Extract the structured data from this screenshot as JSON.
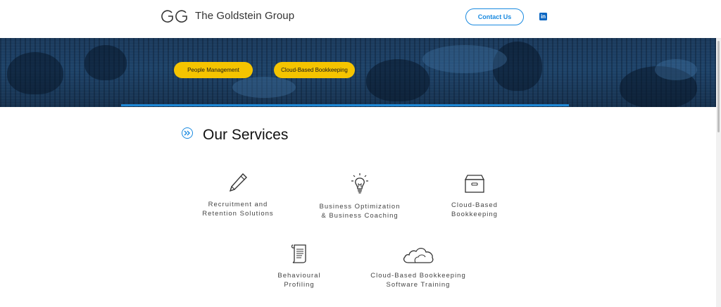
{
  "header": {
    "brand_name": "The Goldstein Group",
    "logo_icon": "gg-monogram-logo",
    "contact_label": "Contact Us",
    "linkedin_label": "in"
  },
  "hero": {
    "pills": [
      {
        "label": "People Management"
      },
      {
        "label": "Cloud-Based Bookkeeping"
      }
    ]
  },
  "services": {
    "title": "Our Services",
    "heading_icon": "double-chevron-right-icon",
    "items": [
      {
        "icon": "pencil-icon",
        "label": "Recruitment and\nRetention Solutions"
      },
      {
        "icon": "lightbulb-icon",
        "label": "Business Optimization\n& Business Coaching"
      },
      {
        "icon": "archive-box-icon",
        "label": "Cloud-Based\nBookkeeping"
      },
      {
        "icon": "scroll-document-icon",
        "label": "Behavioural\nProfiling"
      },
      {
        "icon": "cloud-icon",
        "label": "Cloud-Based Bookkeeping\nSoftware Training"
      }
    ]
  },
  "colors": {
    "accent_blue": "#1a8ae0",
    "pill_yellow": "#f5c400",
    "hero_navy": "#1e4369",
    "linkedin_blue": "#0a66c2"
  }
}
